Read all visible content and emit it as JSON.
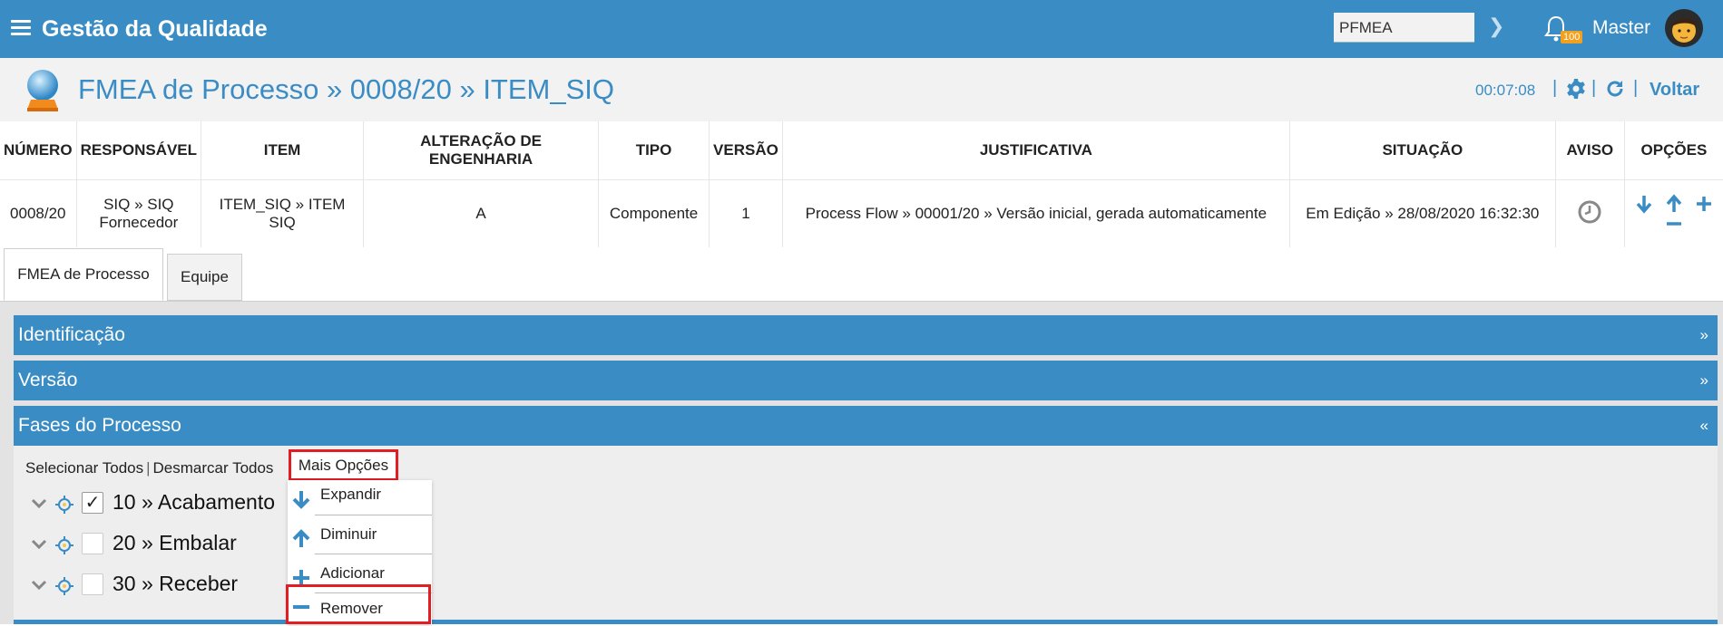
{
  "app": {
    "title": "Gestão da Qualidade",
    "search_value": "PFMEA",
    "notification_count": "100",
    "user_name": "Master"
  },
  "header": {
    "page_title": "FMEA de Processo » 0008/20 » ITEM_SIQ",
    "timer": "00:07:08",
    "back_label": "Voltar"
  },
  "table": {
    "columns": [
      "NÚMERO",
      "RESPONSÁVEL",
      "ITEM",
      "ALTERAÇÃO DE ENGENHARIA",
      "TIPO",
      "VERSÃO",
      "JUSTIFICATIVA",
      "SITUAÇÃO",
      "AVISO",
      "OPÇÕES"
    ],
    "row": {
      "numero": "0008/20",
      "responsavel": "SIQ » SIQ Fornecedor",
      "item": "ITEM_SIQ » ITEM SIQ",
      "alteracao": "A",
      "tipo": "Componente",
      "versao": "1",
      "justificativa": "Process Flow » 00001/20 » Versão inicial, gerada automaticamente",
      "situacao": "Em Edição » 28/08/2020 16:32:30"
    }
  },
  "tabs": [
    {
      "label": "FMEA de Processo",
      "active": true
    },
    {
      "label": "Equipe",
      "active": false
    }
  ],
  "sections": [
    {
      "label": "Identificação",
      "chevron": "»"
    },
    {
      "label": "Versão",
      "chevron": "»"
    },
    {
      "label": "Fases do Processo",
      "chevron": "«"
    }
  ],
  "actions": {
    "select_all": "Selecionar Todos",
    "deselect_all": "Desmarcar Todos",
    "more_options": "Mais Opções"
  },
  "menu": [
    {
      "label": "Expandir",
      "icon": "arrow-down-icon"
    },
    {
      "label": "Diminuir",
      "icon": "arrow-up-icon"
    },
    {
      "label": "Adicionar",
      "icon": "plus-icon"
    },
    {
      "label": "Remover",
      "icon": "minus-icon"
    }
  ],
  "tree": [
    {
      "label": "10 » Acabamento",
      "checked": true
    },
    {
      "label": "20 » Embalar",
      "checked": false
    },
    {
      "label": "30 » Receber",
      "checked": false
    }
  ],
  "colors": {
    "primary": "#3a8cc4",
    "highlight": "#e21d24",
    "badge": "#f2a01e"
  }
}
